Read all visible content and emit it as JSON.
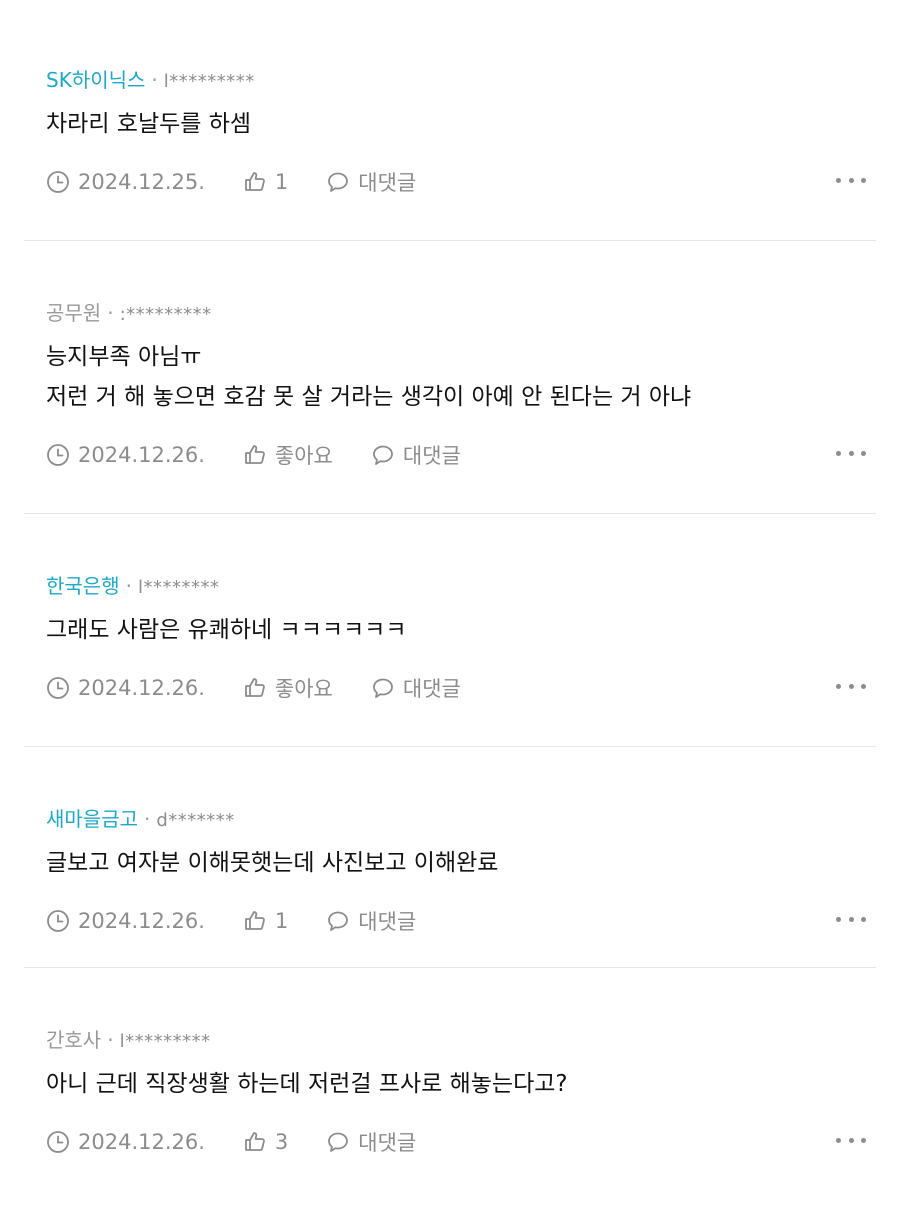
{
  "comments": [
    {
      "affiliation": "SK하이닉스",
      "separator": "·",
      "user": "l*********",
      "lines": [
        "차라리 호날두를 하셈"
      ],
      "date": "2024.12.25.",
      "likes": "1",
      "reply_label": "대댓글",
      "affiliation_color": "#1fa8c4"
    },
    {
      "affiliation": "공무원",
      "separator": "·",
      "user": ":*********",
      "lines": [
        "능지부족 아님ㅠ",
        "저런 거 해 놓으면 호감 못 살 거라는 생각이 아예 안 된다는 거 아냐"
      ],
      "date": "2024.12.26.",
      "likes": "좋아요",
      "reply_label": "대댓글",
      "affiliation_color": "#999999"
    },
    {
      "affiliation": "한국은행",
      "separator": "·",
      "user": "l********",
      "lines": [
        "그래도 사람은 유쾌하네 ㅋㅋㅋㅋㅋㅋ"
      ],
      "date": "2024.12.26.",
      "likes": "좋아요",
      "reply_label": "대댓글",
      "affiliation_color": "#1fa8c4"
    },
    {
      "affiliation": "새마을금고",
      "separator": "·",
      "user": "d*******",
      "lines": [
        "글보고 여자분 이해못햇는데 사진보고 이해완료"
      ],
      "date": "2024.12.26.",
      "likes": "1",
      "reply_label": "대댓글",
      "affiliation_color": "#1fa8c4"
    },
    {
      "affiliation": "간호사",
      "separator": "·",
      "user": "l*********",
      "lines": [
        "아니 근데 직장생활 하는데 저런걸 프사로 해놓는다고?"
      ],
      "date": "2024.12.26.",
      "likes": "3",
      "reply_label": "대댓글",
      "affiliation_color": "#999999"
    }
  ],
  "icons": {
    "clock": "clock-icon",
    "like": "thumbs-up-icon",
    "reply": "speech-bubble-icon",
    "more": "more-dots-icon"
  }
}
